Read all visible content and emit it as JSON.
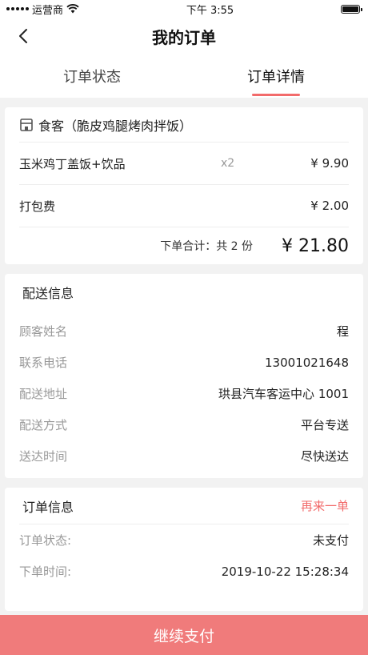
{
  "status_bar": {
    "carrier": "运营商",
    "time": "下午 3:55"
  },
  "nav": {
    "title": "我的订单"
  },
  "tabs": [
    {
      "label": "订单状态",
      "active": false
    },
    {
      "label": "订单详情",
      "active": true
    }
  ],
  "order": {
    "shop_name": "食客（脆皮鸡腿烤肉拌饭）",
    "items": [
      {
        "name": "玉米鸡丁盖饭+饮品",
        "qty": "x2",
        "price": "¥ 9.90"
      },
      {
        "name": "打包费",
        "qty": "",
        "price": "¥ 2.00"
      }
    ],
    "total_label": "下单合计：共 2 份",
    "total_amount": "¥ 21.80"
  },
  "delivery": {
    "title": "配送信息",
    "rows": [
      {
        "label": "顾客姓名",
        "value": "程"
      },
      {
        "label": "联系电话",
        "value": "13001021648"
      },
      {
        "label": "配送地址",
        "value": "珙县汽车客运中心  1001"
      },
      {
        "label": "配送方式",
        "value": "平台专送"
      },
      {
        "label": "送达时间",
        "value": "尽快送达"
      }
    ]
  },
  "order_info": {
    "title": "订单信息",
    "reorder_label": "再来一单",
    "rows": [
      {
        "label": "订单状态:",
        "value": "未支付"
      },
      {
        "label": "下单时间:",
        "value": "2019-10-22 15:28:34"
      }
    ]
  },
  "pay_button": {
    "label": "继续支付"
  },
  "colors": {
    "accent": "#f26b6b",
    "pay_bar": "#f07b7b"
  }
}
